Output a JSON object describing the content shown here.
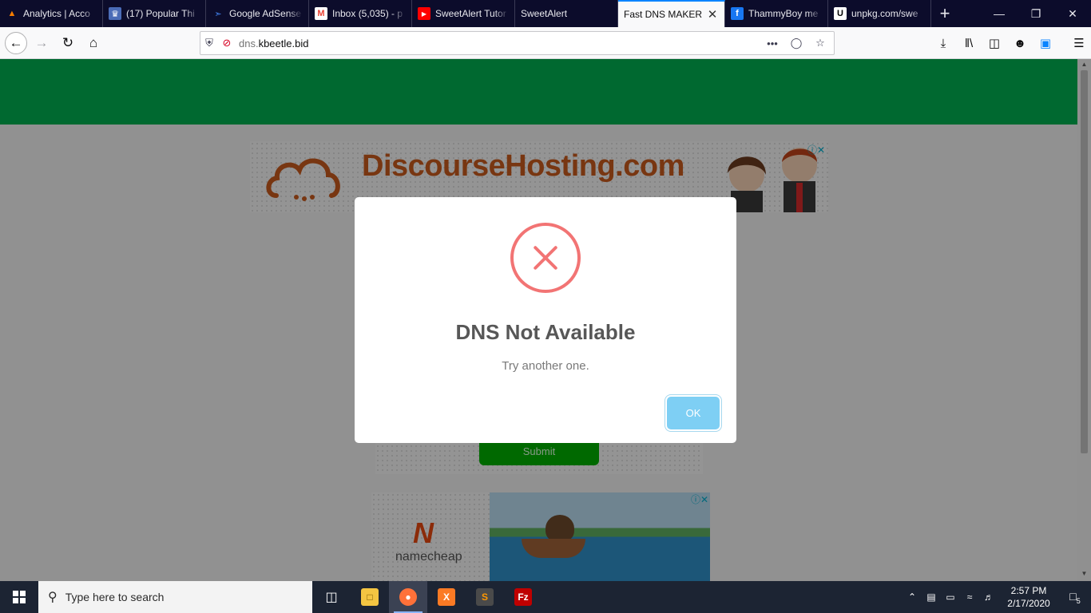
{
  "browser": {
    "tabs": [
      {
        "title": "Analytics | Acco",
        "favicon": "analytics-icon",
        "color": "#f57c00"
      },
      {
        "title": "(17) Popular Thi",
        "favicon": "shield-icon",
        "color": "#4b6cb7"
      },
      {
        "title": "Google AdSense",
        "favicon": "adsense-icon",
        "color": "#4285f4"
      },
      {
        "title": "Inbox (5,035) - p",
        "favicon": "gmail-icon",
        "color": "#ea4335"
      },
      {
        "title": "SweetAlert Tutor",
        "favicon": "youtube-icon",
        "color": "#ff0000"
      },
      {
        "title": "SweetAlert",
        "favicon": "",
        "color": ""
      },
      {
        "title": "Fast DNS MAKER",
        "favicon": "",
        "color": "",
        "active": true
      },
      {
        "title": "ThammyBoy me",
        "favicon": "facebook-icon",
        "color": "#1877f2"
      },
      {
        "title": "unpkg.com/swe",
        "favicon": "unpkg-icon",
        "color": "#ffffff"
      }
    ],
    "url": {
      "host_prefix": "dns.",
      "host_main": "kbeetle.bid"
    }
  },
  "page": {
    "ad_top_brand": "DiscourseHosting.com",
    "submit_label": "Submit",
    "ad_bottom_brand": "namecheap",
    "header_color": "#00b050"
  },
  "dialog": {
    "icon": "error-x-icon",
    "title": "DNS Not Available",
    "text": "Try another one.",
    "ok_label": "OK",
    "accent": "#f27474"
  },
  "taskbar": {
    "search_placeholder": "Type here to search",
    "time": "2:57 PM",
    "date": "2/17/2020",
    "notification_count": "5"
  }
}
